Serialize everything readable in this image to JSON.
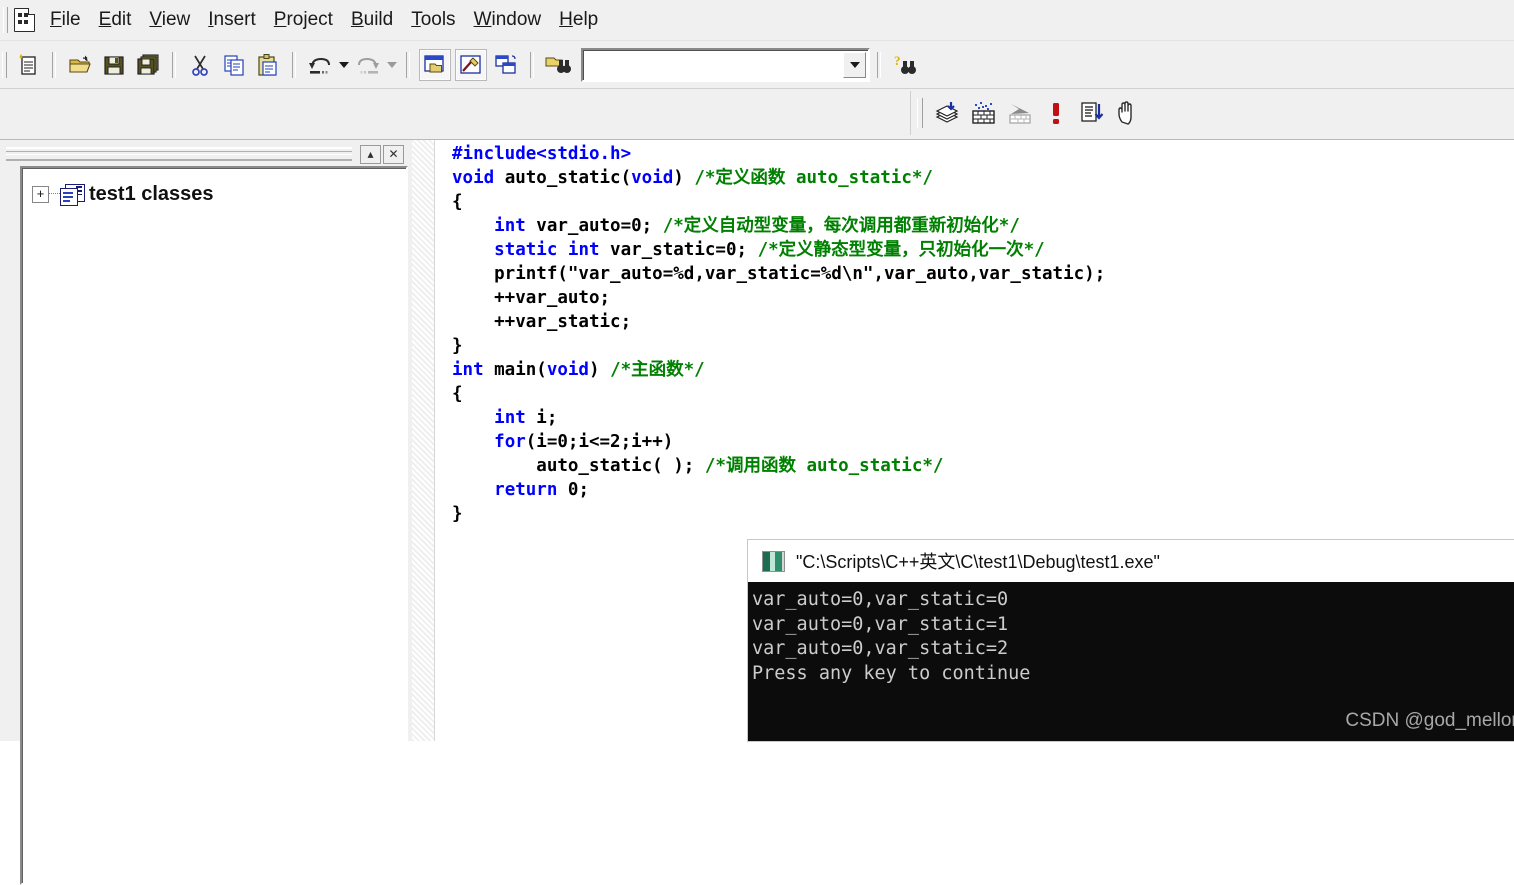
{
  "menubar": {
    "app_icon": "document-star-icon",
    "items": [
      {
        "label": "File",
        "accel": "F"
      },
      {
        "label": "Edit",
        "accel": "E"
      },
      {
        "label": "View",
        "accel": "V"
      },
      {
        "label": "Insert",
        "accel": "I"
      },
      {
        "label": "Project",
        "accel": "P"
      },
      {
        "label": "Build",
        "accel": "B"
      },
      {
        "label": "Tools",
        "accel": "T"
      },
      {
        "label": "Window",
        "accel": "W"
      },
      {
        "label": "Help",
        "accel": "H"
      }
    ]
  },
  "toolbar": {
    "buttons": [
      {
        "name": "new-text-file-button",
        "icon": "new-document-icon"
      },
      {
        "name": "open-button",
        "icon": "open-folder-icon"
      },
      {
        "name": "save-button",
        "icon": "floppy-disk-icon"
      },
      {
        "name": "save-all-button",
        "icon": "save-all-icon"
      },
      {
        "name": "cut-button",
        "icon": "scissors-icon"
      },
      {
        "name": "copy-button",
        "icon": "copy-pages-icon"
      },
      {
        "name": "paste-button",
        "icon": "clipboard-icon"
      },
      {
        "name": "undo-button",
        "icon": "undo-arrow-icon"
      },
      {
        "name": "redo-button",
        "icon": "redo-arrow-icon"
      },
      {
        "name": "workspace-button",
        "icon": "workspace-window-icon"
      },
      {
        "name": "output-window-button",
        "icon": "output-hammer-icon"
      },
      {
        "name": "window-list-button",
        "icon": "cascade-windows-icon"
      },
      {
        "name": "find-in-files-button",
        "icon": "binoculars-folder-icon"
      },
      {
        "name": "search-help-button",
        "icon": "question-binoculars-icon"
      }
    ],
    "search_combo": {
      "value": "",
      "placeholder": ""
    }
  },
  "minibar": {
    "buttons": [
      {
        "name": "compile-button",
        "icon": "compile-stack-icon",
        "enabled": true
      },
      {
        "name": "build-button",
        "icon": "build-bricks-icon",
        "enabled": true
      },
      {
        "name": "stop-build-button",
        "icon": "stop-build-icon",
        "enabled": false
      },
      {
        "name": "go-button",
        "icon": "red-exclamation-icon",
        "enabled": true
      },
      {
        "name": "execute-button",
        "icon": "execute-arrow-icon",
        "enabled": true
      },
      {
        "name": "insert-breakpoint-button",
        "icon": "hand-icon",
        "enabled": true
      }
    ]
  },
  "workspace": {
    "caption_buttons": [
      {
        "name": "workspace-minimize-button",
        "glyph": "▴"
      },
      {
        "name": "workspace-close-button",
        "glyph": "✕"
      }
    ],
    "tree": {
      "expander": "+",
      "icon": "class-folder-icon",
      "label": "test1 classes"
    }
  },
  "editor": {
    "lines": [
      [
        {
          "t": "#include<stdio.h>",
          "c": "pp"
        }
      ],
      [
        {
          "t": "void",
          "c": "kw"
        },
        {
          "t": " auto_static(",
          "c": "pl"
        },
        {
          "t": "void",
          "c": "kw"
        },
        {
          "t": ") ",
          "c": "pl"
        },
        {
          "t": "/*定义函数 auto_static*/",
          "c": "cm"
        }
      ],
      [
        {
          "t": "{",
          "c": "pl"
        }
      ],
      [
        {
          "t": "    ",
          "c": "pl"
        },
        {
          "t": "int",
          "c": "kw"
        },
        {
          "t": " var_auto=0; ",
          "c": "pl"
        },
        {
          "t": "/*定义自动型变量，每次调用都重新初始化*/",
          "c": "cm"
        }
      ],
      [
        {
          "t": "    ",
          "c": "pl"
        },
        {
          "t": "static int",
          "c": "kw"
        },
        {
          "t": " var_static=0; ",
          "c": "pl"
        },
        {
          "t": "/*定义静态型变量，只初始化一次*/",
          "c": "cm"
        }
      ],
      [
        {
          "t": "    printf(\"var_auto=%d,var_static=%d\\n\",var_auto,var_static);",
          "c": "pl"
        }
      ],
      [
        {
          "t": "    ++var_auto;",
          "c": "pl"
        }
      ],
      [
        {
          "t": "    ++var_static;",
          "c": "pl"
        }
      ],
      [
        {
          "t": "}",
          "c": "pl"
        }
      ],
      [
        {
          "t": "int",
          "c": "kw"
        },
        {
          "t": " main(",
          "c": "pl"
        },
        {
          "t": "void",
          "c": "kw"
        },
        {
          "t": ") ",
          "c": "pl"
        },
        {
          "t": "/*主函数*/",
          "c": "cm"
        }
      ],
      [
        {
          "t": "{",
          "c": "pl"
        }
      ],
      [
        {
          "t": "    ",
          "c": "pl"
        },
        {
          "t": "int",
          "c": "kw"
        },
        {
          "t": " i;",
          "c": "pl"
        }
      ],
      [
        {
          "t": "    ",
          "c": "pl"
        },
        {
          "t": "for",
          "c": "kw"
        },
        {
          "t": "(i=0;i<=2;i++)",
          "c": "pl"
        }
      ],
      [
        {
          "t": "        auto_static( ); ",
          "c": "pl"
        },
        {
          "t": "/*调用函数 auto_static*/",
          "c": "cm"
        }
      ],
      [
        {
          "t": "    ",
          "c": "pl"
        },
        {
          "t": "return",
          "c": "kw"
        },
        {
          "t": " 0;",
          "c": "pl"
        }
      ],
      [
        {
          "t": "}",
          "c": "pl"
        }
      ]
    ]
  },
  "console": {
    "icon": "console-window-icon",
    "title": "\"C:\\Scripts\\C++英文\\C\\test1\\Debug\\test1.exe\"",
    "output": [
      "var_auto=0,var_static=0",
      "var_auto=0,var_static=1",
      "var_auto=0,var_static=2",
      "Press any key to continue"
    ],
    "watermark": "CSDN @god_mellon"
  },
  "colors": {
    "keyword": "#0000ff",
    "comment": "#008000",
    "plain": "#000000",
    "console_bg": "#0c0c0c",
    "console_fg": "#cccccc",
    "chrome": "#f0f0f0"
  }
}
